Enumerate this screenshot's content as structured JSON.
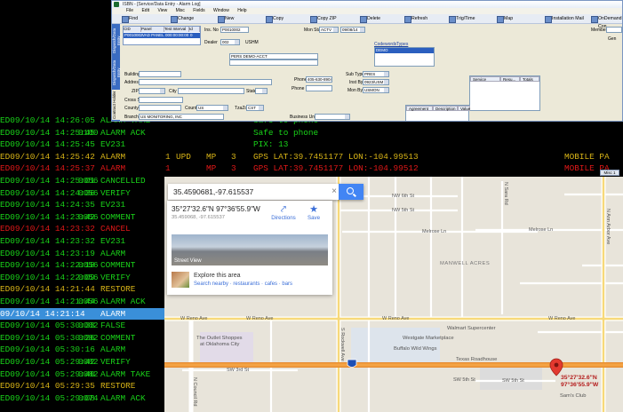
{
  "data_entry": {
    "title": "ISBN - [Service/Data Entry - Alarm Log]",
    "menu": [
      "File",
      "Edit",
      "View",
      "Misc",
      "Fields",
      "Window",
      "Help"
    ],
    "toolbar": [
      "Find",
      "Change",
      "New",
      "Copy",
      "Copy ZIP",
      "Delete",
      "Refresh",
      "Trig/Time",
      "Map",
      "Installation Mail",
      "OnDemand Con"
    ],
    "side_tabs": [
      "Dispatch/Data Entry",
      "Dispatch/Data Entry",
      "Contract Holder"
    ],
    "grid_headers": [
      "CID",
      "Panel",
      "Test Interval",
      "Id"
    ],
    "grid_row": [
      "P0010002",
      "VAD PANEL",
      "000:00:00:00",
      "0"
    ],
    "fields": {
      "ins_no_label": "Ins. No",
      "ins_no": "P0010002",
      "mon_stat_label": "Mon Stat",
      "mon_stat": "ACTV",
      "mon_date": "09/08/14",
      "dealer_label": "Dealer",
      "dealer": "002",
      "dealer_name": "USHM",
      "codewords_label": "Codewords",
      "types_label": "Types",
      "codeword_sel": "DEMO",
      "account_name": "PERS DEMO-ACCT",
      "building_label": "Building",
      "address_label": "Address",
      "zip_label": "ZIP",
      "city_label": "City",
      "state_label": "State",
      "phone_label": "Phone",
      "phone": "405-630-8904",
      "phone2_label": "Phone 2",
      "cross_st_label": "Cross St",
      "county_label": "County",
      "country_label": "Country",
      "country": "US",
      "tzo_label": "TzaZo",
      "tz": "CST",
      "sub_type_label": "Sub Type",
      "sub_type": "PRES",
      "inst_by_label": "Inst By",
      "inst_by": "0923/USM",
      "mon_by_label": "Mon By",
      "mon_by": "USMON",
      "branch_label": "Branch",
      "branch": "US MONITORING, INC",
      "bus_unit_label": "Business Unit",
      "member_label": "Member",
      "gen_label": "Gen"
    },
    "service_headers": [
      "Service",
      "Resu...",
      "Totals"
    ],
    "agreement_headers": [
      "Agreement",
      "Description",
      "Value"
    ]
  },
  "alarm_log": {
    "rows": [
      {
        "ts": "ED09/10/14 14:26:05",
        "code": "",
        "event": "ALARM TAKE",
        "n1": "",
        "upd": "",
        "mp": "",
        "n3": "",
        "info": "Safe to phone",
        "right": "",
        "color": "#19d219"
      },
      {
        "ts": "ED09/10/14 14:25:45",
        "code": "0100",
        "event": "ALARM ACK",
        "n1": "",
        "upd": "",
        "mp": "",
        "n3": "",
        "info": "Safe to phone",
        "right": "",
        "color": "#19d219"
      },
      {
        "ts": "ED09/10/14 14:25:45",
        "code": "",
        "event": "EV231",
        "n1": "",
        "upd": "",
        "mp": "",
        "n3": "",
        "info": "PIX: 13",
        "right": "",
        "color": "#19d219"
      },
      {
        "ts": "ED09/10/14 14:25:42",
        "code": "",
        "event": "ALARM",
        "n1": "1",
        "upd": "UPD",
        "mp": "MP",
        "n3": "3",
        "info": "GPS LAT:39.7451177 LON:-104.99513",
        "right": "MOBILE PA",
        "color": "#d8b417"
      },
      {
        "ts": "ED09/10/14 14:25:37",
        "code": "",
        "event": "ALARM",
        "n1": "1",
        "upd": "",
        "mp": "MP",
        "n3": "3",
        "info": "GPS LAT:39.7451177 LON:-104.99512",
        "right": "MOBILE PA",
        "color": "#e01818"
      },
      {
        "ts": "ED09/10/14 14:25:01",
        "code": "0056",
        "event": "CANCELLED",
        "n1": "",
        "upd": "",
        "mp": "",
        "n3": "",
        "info": "",
        "right": "",
        "color": "#19d219"
      },
      {
        "ts": "ED09/10/14 14:24:36",
        "code": "0056",
        "event": "VERIFY",
        "n1": "",
        "upd": "",
        "mp": "",
        "n3": "",
        "info": "",
        "right": "",
        "color": "#19d219"
      },
      {
        "ts": "ED09/10/14 14:24:35",
        "code": "",
        "event": "EV231",
        "n1": "",
        "upd": "",
        "mp": "",
        "n3": "",
        "info": "",
        "right": "",
        "color": "#19d219"
      },
      {
        "ts": "ED09/10/14 14:23:42",
        "code": "0056",
        "event": "COMMENT",
        "n1": "",
        "upd": "",
        "mp": "",
        "n3": "",
        "info": "",
        "right": "",
        "color": "#19d219"
      },
      {
        "ts": "ED09/10/14 14:23:32",
        "code": "",
        "event": "CANCEL",
        "n1": "",
        "upd": "",
        "mp": "",
        "n3": "",
        "info": "",
        "right": "",
        "color": "#e01818"
      },
      {
        "ts": "ED09/10/14 14:23:32",
        "code": "",
        "event": "EV231",
        "n1": "",
        "upd": "",
        "mp": "",
        "n3": "",
        "info": "",
        "right": "",
        "color": "#19d219"
      },
      {
        "ts": "ED09/10/14 14:23:19",
        "code": "",
        "event": "ALARM",
        "n1": "",
        "upd": "",
        "mp": "",
        "n3": "",
        "info": "",
        "right": "",
        "color": "#19d219"
      },
      {
        "ts": "ED09/10/14 14:22:18",
        "code": "0056",
        "event": "COMMENT",
        "n1": "",
        "upd": "",
        "mp": "",
        "n3": "",
        "info": "",
        "right": "",
        "color": "#19d219"
      },
      {
        "ts": "ED09/10/14 14:22:09",
        "code": "0056",
        "event": "VERIFY",
        "n1": "",
        "upd": "",
        "mp": "",
        "n3": "",
        "info": "",
        "right": "",
        "color": "#19d219"
      },
      {
        "ts": "ED09/10/14 14:21:44",
        "code": "",
        "event": "RESTORE",
        "n1": "",
        "upd": "",
        "mp": "",
        "n3": "",
        "info": "",
        "right": "",
        "color": "#d8b417"
      },
      {
        "ts": "ED09/10/14 14:21:44",
        "code": "0056",
        "event": "ALARM ACK",
        "n1": "",
        "upd": "",
        "mp": "",
        "n3": "",
        "info": "",
        "right": "",
        "color": "#19d219"
      },
      {
        "ts": "   09/10/14 14:21:14",
        "code": "",
        "event": "ALARM",
        "n1": "",
        "upd": "",
        "mp": "",
        "n3": "",
        "info": "",
        "right": "",
        "color": "#ffffff",
        "selected": true
      },
      {
        "ts": "ED09/10/14 05:30:33",
        "code": "0082",
        "event": "FALSE",
        "n1": "",
        "upd": "",
        "mp": "",
        "n3": "",
        "info": "",
        "right": "",
        "color": "#19d219"
      },
      {
        "ts": "ED09/10/14 05:30:26",
        "code": "0082",
        "event": "COMMENT",
        "n1": "",
        "upd": "",
        "mp": "",
        "n3": "",
        "info": "",
        "right": "",
        "color": "#19d219"
      },
      {
        "ts": "ED09/10/14 05:30:16",
        "code": "",
        "event": "ALARM",
        "n1": "",
        "upd": "",
        "mp": "",
        "n3": "",
        "info": "",
        "right": "",
        "color": "#19d219"
      },
      {
        "ts": "ED09/10/14 05:29:42",
        "code": "0082",
        "event": "VERIFY",
        "n1": "",
        "upd": "",
        "mp": "",
        "n3": "",
        "info": "",
        "right": "",
        "color": "#19d219"
      },
      {
        "ts": "ED09/10/14 05:29:40",
        "code": "0082",
        "event": "ALARM TAKE",
        "n1": "",
        "upd": "",
        "mp": "",
        "n3": "",
        "info": "",
        "right": "",
        "color": "#19d219"
      },
      {
        "ts": "ED09/10/14 05:29:35",
        "code": "",
        "event": "RESTORE",
        "n1": "",
        "upd": "",
        "mp": "",
        "n3": "",
        "info": "",
        "right": "",
        "color": "#d8b417"
      },
      {
        "ts": "ED09/10/14 05:29:08",
        "code": "0074",
        "event": "ALARM ACK",
        "n1": "",
        "upd": "",
        "mp": "",
        "n3": "",
        "info": "",
        "right": "",
        "color": "#19d219"
      }
    ]
  },
  "map": {
    "misc_button": "Misc 1",
    "search_value": "35.4590681,-97.615537",
    "dms": "35°27'32.6\"N 97°36'55.9\"W",
    "decimal": "35.459068, -97.615537",
    "directions_label": "Directions",
    "save_label": "Save",
    "street_view_label": "Street View",
    "explore_title": "Explore this area",
    "explore_links": "Search nearby · restaurants · cafes · bars",
    "pin_label_1": "35°27'32.6\"N",
    "pin_label_2": "97°36'55.9\"W",
    "streets": {
      "nw6": "NW 6th St",
      "nw5": "NW 5th St",
      "melrose1": "Melrose Ln",
      "melrose2": "Melrose Ln",
      "reno1": "W Reno Ave",
      "reno2": "W Reno Ave",
      "reno3": "W Reno Ave",
      "reno4": "W Reno Ave",
      "sw3": "SW 3rd St",
      "sw5": "SW 5th St",
      "sw5b": "SW 5th St",
      "mustang": "S Mustang Rd",
      "rockwell": "S Rockwell Ave",
      "harvard": "N Ann Arbor Ave",
      "council": "N Council Rd",
      "post": "N Sara Rd",
      "pr": "N Post Rd"
    },
    "pois": {
      "manwell": "MANWELL ACRES",
      "walmart": "Walmart Supercenter",
      "westgate": "Westgate Marketplace",
      "buffalo": "Buffalo Wild Wings",
      "texas": "Texas Roadhouse",
      "outlets1": "The Outlet Shoppes",
      "outlets2": "at Oklahoma City",
      "sams": "Sam's Club",
      "hwy": "40"
    }
  }
}
